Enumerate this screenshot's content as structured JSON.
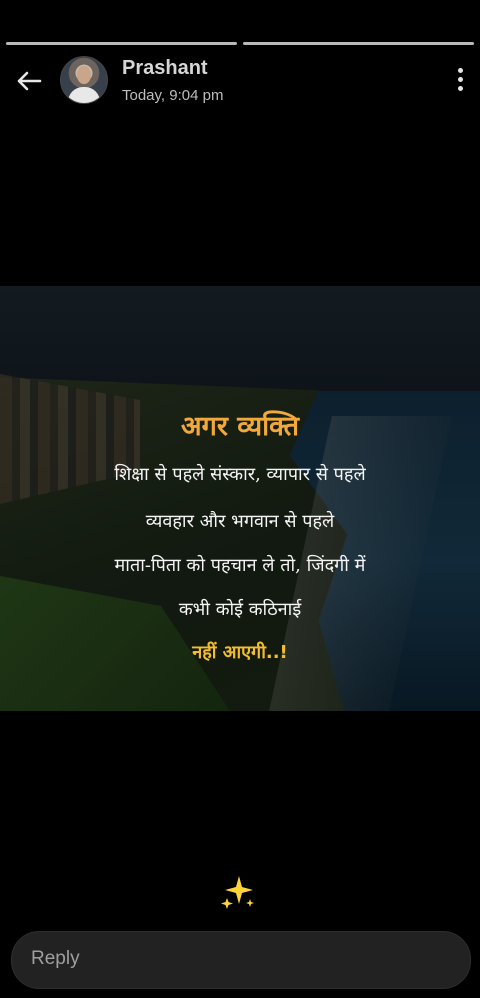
{
  "header": {
    "name": "Prashant",
    "timestamp": "Today, 9:04 pm",
    "back_icon": "arrow-left-icon",
    "menu_icon": "more-vertical-icon"
  },
  "story": {
    "title": "अगर व्यक्ति",
    "lines": [
      "शिक्षा से पहले संस्कार, व्यापार से पहले",
      "व्यवहार और भगवान से पहले",
      "माता-पिता को पहचान ले तो, जिंदगी में",
      "कभी कोई कठिनाई"
    ],
    "closing": "नहीं आएगी..!",
    "accent_color": "#f2a93b"
  },
  "caption": {
    "emoji": "✨"
  },
  "reply": {
    "placeholder": "Reply"
  }
}
